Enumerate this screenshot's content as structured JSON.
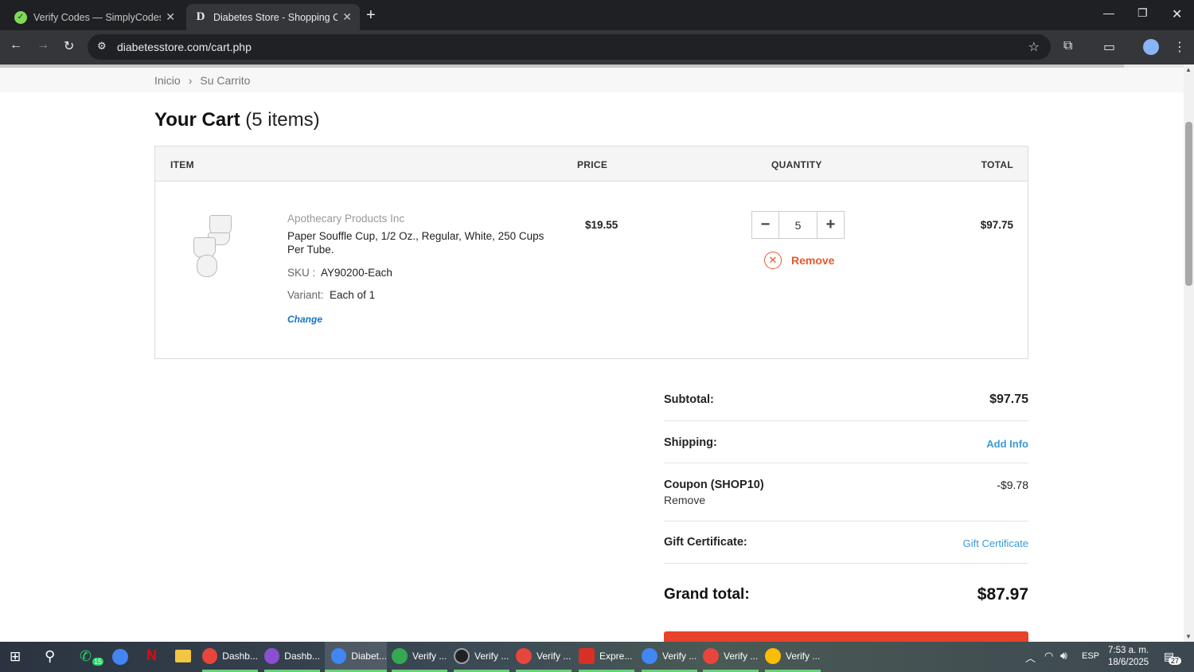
{
  "browser": {
    "tabs": [
      {
        "title": "Verify Codes — SimplyCodes",
        "active": false
      },
      {
        "title": "Diabetes Store - Shopping Cart",
        "active": true
      }
    ],
    "url": "diabetesstore.com/cart.php"
  },
  "breadcrumb": {
    "home": "Inicio",
    "separator": "›",
    "current": "Su Carrito"
  },
  "cart": {
    "title": "Your Cart",
    "count_label": "(5 items)",
    "columns": {
      "item": "ITEM",
      "price": "PRICE",
      "quantity": "QUANTITY",
      "total": "TOTAL"
    },
    "item": {
      "brand": "Apothecary Products Inc",
      "name": "Paper Souffle Cup, 1/2 Oz., Regular, White, 250 Cups Per Tube.",
      "sku_label": "SKU :",
      "sku": "AY90200-Each",
      "variant_label": "Variant:",
      "variant": "Each of 1",
      "change_label": "Change",
      "price": "$19.55",
      "quantity": "5",
      "remove_label": "Remove",
      "total": "$97.75"
    }
  },
  "summary": {
    "subtotal_label": "Subtotal:",
    "subtotal": "$97.75",
    "shipping_label": "Shipping:",
    "shipping_action": "Add Info",
    "coupon_label": "Coupon (SHOP10)",
    "coupon_remove": "Remove",
    "coupon_value": "-$9.78",
    "gift_label": "Gift Certificate:",
    "gift_action": "Gift Certificate",
    "grand_label": "Grand total:",
    "grand_total": "$87.97"
  },
  "taskbar": {
    "items": [
      {
        "label": "Dashb...",
        "color": "#e8453c"
      },
      {
        "label": "Dashb...",
        "color": "#8b4fd1"
      },
      {
        "label": "Diabet...",
        "color": "#4285f4"
      },
      {
        "label": "Verify ...",
        "color": "#34a853"
      },
      {
        "label": "Verify ...",
        "color": "#202124"
      },
      {
        "label": "Verify ...",
        "color": "#e8453c"
      },
      {
        "label": "Expre...",
        "color": "#d93025"
      },
      {
        "label": "Verify ...",
        "color": "#4285f4"
      },
      {
        "label": "Verify ...",
        "color": "#e8453c"
      },
      {
        "label": "Verify ...",
        "color": "#fbbc04"
      }
    ],
    "whatsapp_badge": "15",
    "language": "ESP",
    "time": "7:53 a. m.",
    "date": "18/6/2025",
    "notifications": "27"
  }
}
